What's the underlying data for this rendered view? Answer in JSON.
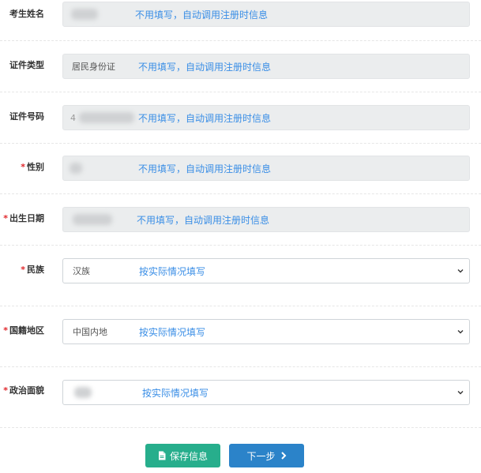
{
  "fields": [
    {
      "label": "考生姓名",
      "required": false,
      "value": "",
      "hint": "不用填写，自动调用注册时信息"
    },
    {
      "label": "证件类型",
      "required": false,
      "value": "居民身份证",
      "hint": "不用填写，自动调用注册时信息"
    },
    {
      "label": "证件号码",
      "required": false,
      "value": "4",
      "hint": "不用填写，自动调用注册时信息"
    },
    {
      "label": "性别",
      "required": true,
      "value": "",
      "hint": "不用填写，自动调用注册时信息"
    },
    {
      "label": "出生日期",
      "required": true,
      "value": "",
      "hint": "不用填写，自动调用注册时信息"
    },
    {
      "label": "民族",
      "required": true,
      "value": "汉族",
      "hint": "按实际情况填写"
    },
    {
      "label": "国籍地区",
      "required": true,
      "value": "中国内地",
      "hint": "按实际情况填写"
    },
    {
      "label": "政治面貌",
      "required": true,
      "value": "",
      "hint": "按实际情况填写"
    }
  ],
  "required_mark": "*",
  "buttons": {
    "save": "保存信息",
    "next": "下一步"
  },
  "icons": {
    "save": "document-icon",
    "next": "chevron-right-icon",
    "select": "chevron-down-icon"
  },
  "colors": {
    "hint": "#3a8ee6",
    "required": "#e0262a",
    "save_bg": "#27ae8c",
    "next_bg": "#2b83c9"
  }
}
